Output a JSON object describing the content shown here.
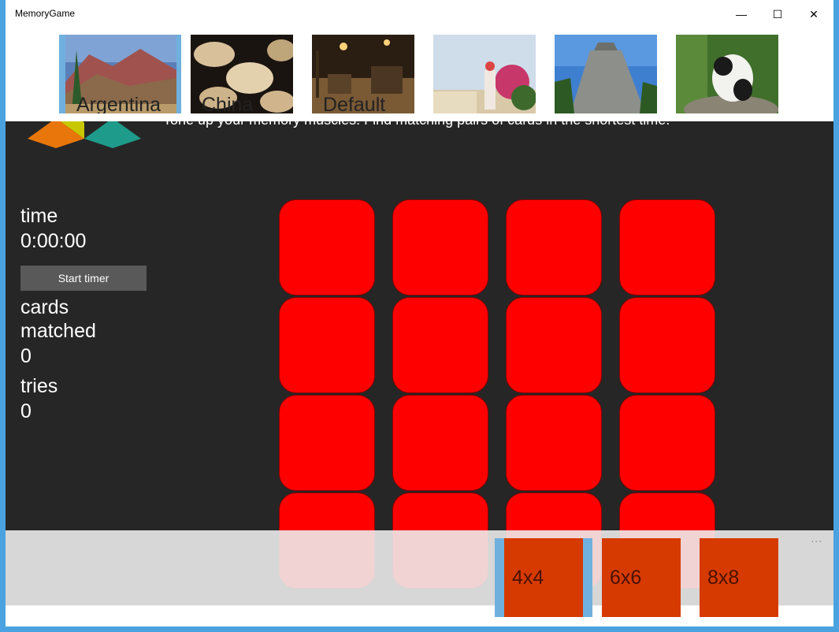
{
  "window": {
    "title": "MemoryGame",
    "controls": {
      "minimize": "—",
      "maximize": "☐",
      "close": "✕"
    }
  },
  "themes": [
    {
      "label": "Argentina",
      "selected": true
    },
    {
      "label": "China",
      "selected": false
    },
    {
      "label": "Default",
      "selected": false
    },
    {
      "label": "",
      "selected": false
    },
    {
      "label": "",
      "selected": false
    },
    {
      "label": "",
      "selected": false
    }
  ],
  "header": {
    "tagline": "Tone up your memory muscles. Find matching pairs of cards in the shortest time."
  },
  "stats": {
    "time_label": "time",
    "time_value": "0:00:00",
    "start_button": "Start timer",
    "cards_label_1": "cards",
    "cards_label_2": "matched",
    "cards_value": "0",
    "tries_label": "tries",
    "tries_value": "0"
  },
  "board": {
    "rows": 4,
    "cols": 4,
    "card_color": "#ff0000"
  },
  "sizes": [
    {
      "label": "4x4",
      "selected": true
    },
    {
      "label": "6x6",
      "selected": false
    },
    {
      "label": "8x8",
      "selected": false
    }
  ],
  "appbar": {
    "more": "..."
  },
  "colors": {
    "accent": "#d63a00",
    "selection": "#6fb0de",
    "background": "#262626"
  }
}
